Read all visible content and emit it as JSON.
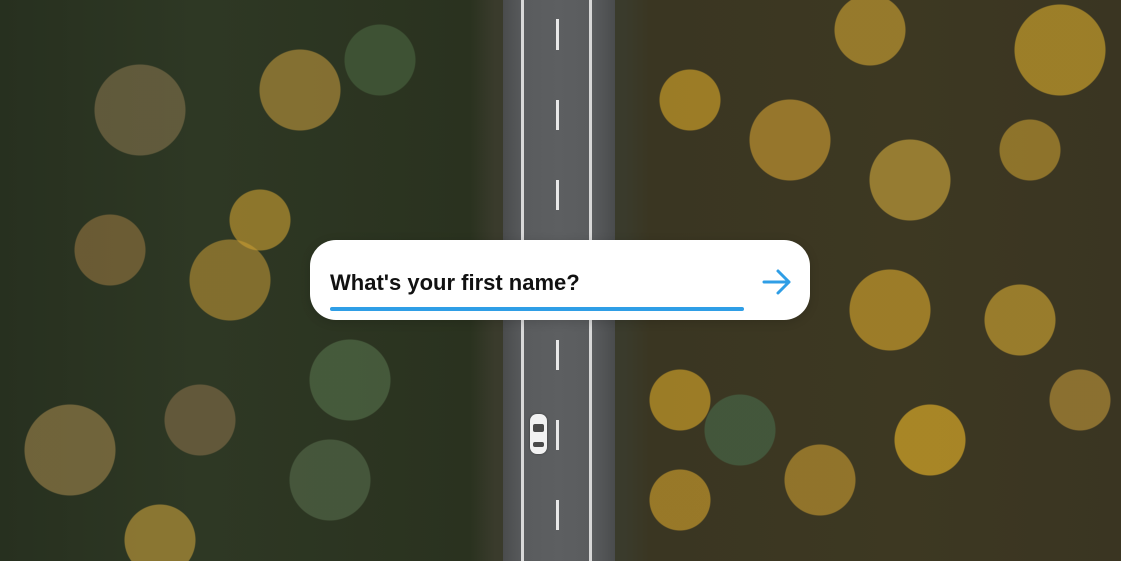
{
  "form": {
    "question": "What's your first name?",
    "input_value": "",
    "accent_color": "#2f9ee6",
    "submit_icon": "arrow-right-icon"
  },
  "background": {
    "description_icon": "aerial-forest-road-image"
  }
}
